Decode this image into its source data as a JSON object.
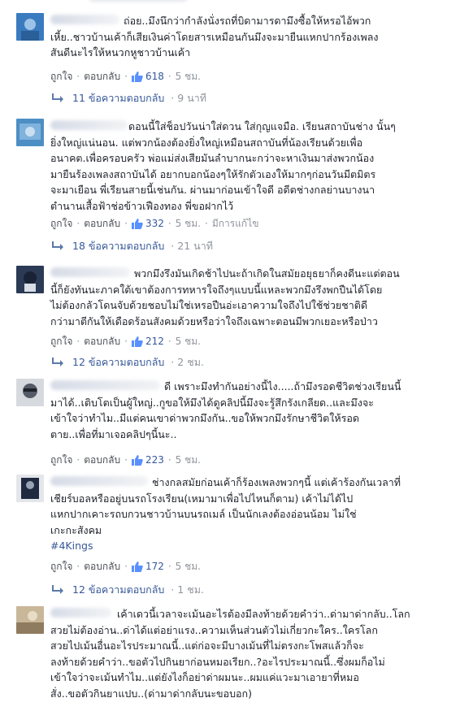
{
  "labels": {
    "like": "ถูกใจ",
    "reply": "ตอบกลับ",
    "edited": "มีการแก้ไข"
  },
  "top_partial": {
    "time": "9 นาที"
  },
  "comments": [
    {
      "text": "ถ่อย..มึงนึกว่ากำลังนั่งรถที่บิดามารดามึงซื้อให้หรอไอ้พวก\nเหี้ย..ชาวบ้านเค้าก็เสียเงินค่าโดยสารเหมือนกันมึงจะมายืนแหกปากร้องเพลง\nสันดีนะไรให้หนวกหูชาวบ้านเค้า",
      "likes": "618",
      "time": "5 ชม.",
      "edited": false,
      "replies": "11 ข้อความตอบกลับ",
      "reply_time": "9 นาที",
      "avatar": "#3a7bbf"
    },
    {
      "text": "ดอนนี้ใส่ช็อปวันน่าใส่ดวน ใส่กุญแจมือ. เรียนสถาบันช่าง นั้นๆ\nยิ่งใหญ่แน่นอน. แต่พวกน้องต้องยิ่งใหญ่เหมือนสถาบันที่น้องเรียนด้วยเพื่อ\nอนาคต.เพื่อครอบครัว พ่อแม่ส่งเสียมันลำบากนะกว่าจะหาเงินมาส่งพวกน้อง\nมายืนร้องเพลงสถาบันได้ อยากบอกน้องๆให้รักตัวเองให้มากๆก่อนวันมีตมิตร\nจะมาเยือน พี่เรียนสายนี้เช่นกัน. ผ่านมาก่อนเข้าใจดี อดีตช่างกลย่านบางนา\nตำนานเสื้อฟ้าช่อข้าวเฟืองทอง พี่ขอฝากไว้",
      "likes": "332",
      "time": "5 ชม.",
      "edited": true,
      "replies": "18 ข้อความตอบกลับ",
      "reply_time": "21 นาที",
      "avatar": "#4d8fc4"
    },
    {
      "text": "พวกมึงรึงมันเกิดช้าไปนะถ้าเกิดในสมัยอยุธยาก็คงดีนะแต่ตอน\nนี้ก็ยังทันนะภาคใต้เขาต้องการทหารใจถึงๆแบบนี้แหละพวกมึงรึงพกปืนได้โดย\nไม่ต้องกลัวโดนจับด้วยชอบไม่ใช่เหรอปืนอ่ะเอาความใจถึงไปใช้ช่วยชาติดี\nกว่ามาตีกันให้เดือดร้อนสังคมด้วยหรือว่าใจถึงเฉพาะตอนมีพวกเยอะหรือป่าว",
      "likes": "212",
      "time": "5 ชม.",
      "edited": false,
      "replies": "12 ข้อความตอบกลับ",
      "reply_time": "2 ชม.",
      "avatar": "#2b3a55"
    },
    {
      "text": "ดี เพราะมึงทำกันอย่างนี้ไง.....ถ้ามึงรอดชีวิตช่วงเรียนนี้\nมาได้..เติบโตเป็นผู้ใหญ่..กูขอให้มึงได้ดูคลิปนี้มึงจะรู้สึกรังเกลียด..และมึงจะ\nเข้าใจว่าทำไม..มีแต่คนเขาด่าพวกมึงกัน..ขอให้พวกมึงรักษาชีวิตให้รอด\nตาย..เพื่อที่มาเจอคลิปๆนี้นะ..",
      "likes": "223",
      "time": "5 ชม.",
      "edited": false,
      "replies": "",
      "reply_time": "",
      "avatar": "#555b66"
    },
    {
      "text": "ช่างกลสมัยก่อนเค้าก็ร้องเพลงพวกๆนี้ แต่เค้าร้องกันเวลาที่\nเชียร์บอลหรืออยู่บนรถโรงเรียน(เหมามาเพื่อไปไหนก็ตาม) เค้าไม่ได้ไป\nแหกปากเคาะรถบกวนชาวบ้านบนรถเมล์ เป็นนักเลงต้องอ่อนน้อม ไม่ใช่\nเกะกะสังคม",
      "tag": "#4Kings",
      "likes": "172",
      "time": "5 ชม.",
      "edited": false,
      "replies": "12 ข้อความตอบกลับ",
      "reply_time": "1 ชม.",
      "avatar": "#1f2a40"
    },
    {
      "text": "เค้าเดวนี้เวลาจะเม้นอะไรต้องมีลงท้ายด้วยคำว่า..ด่ามาด่ากลับ..โลก\nสวยไม่ต้องอ่าน..ด่าได้แต่อย่าแรง..ความเห็นส่วนตัวไม่เกี่ยวกะใคร..ใครโลก\nสวยไปเม้นอื่นอะไรประมาณนี้..แต่ก่อจะมีบางเม้นที่ไม่ตรงกะโพสแล้วก็จะ\nลงท้ายด้วยคำว่า..ขอตัวไปกินยาก่อนหมอเรียก..?อะไรประมาณนี้..ซึ่งผมก็อไม่\nเข้าใจว่าจะเม้นทำไม..แต่ยังไงก็อย่าด่าผมนะ..ผมแค่แวะมาเอายาที่หมอ\nสั่ง..ขอตัวกินยาแปบ..(ด่ามาด่ากลับนะขอบอก)",
      "likes": "",
      "time": "",
      "edited": false,
      "replies": "",
      "reply_time": "",
      "avatar": "#c9b79a"
    }
  ],
  "colors": {
    "link": "#365899",
    "meta": "#90949c",
    "text": "#1d2129"
  },
  "icons": {
    "like": "thumbs-up-icon",
    "reply": "reply-arrow-icon"
  }
}
